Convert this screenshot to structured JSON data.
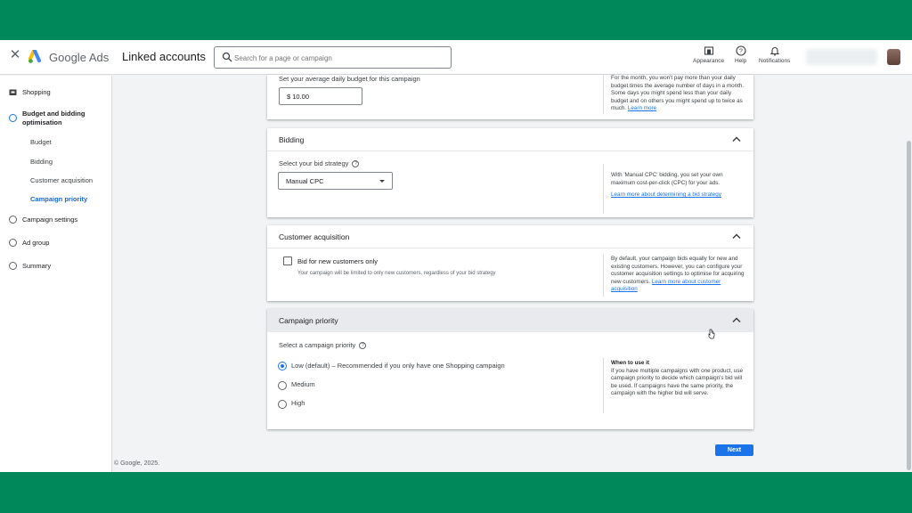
{
  "header": {
    "brand": "Google Ads",
    "page_title": "Linked accounts",
    "search_placeholder": "Search for a page or campaign",
    "tools": [
      {
        "label": "Appearance",
        "icon": "appearance-icon"
      },
      {
        "label": "Help",
        "icon": "help-icon"
      },
      {
        "label": "Notifications",
        "icon": "bell-icon"
      }
    ]
  },
  "sidebar": {
    "items": [
      {
        "label": "Shopping",
        "icon": "shopping-icon"
      },
      {
        "label": "Budget and bidding optimisation",
        "icon": "step-circle-icon",
        "active": true
      },
      {
        "label": "Campaign settings",
        "icon": "step-circle-icon"
      },
      {
        "label": "Ad group",
        "icon": "step-circle-icon"
      },
      {
        "label": "Summary",
        "icon": "step-circle-icon"
      }
    ],
    "sub_items": [
      "Budget",
      "Bidding",
      "Customer acquisition",
      "Campaign priority"
    ],
    "active_sub_item": "Campaign priority"
  },
  "budget": {
    "label": "Set your average daily budget for this campaign",
    "value": "$ 10.00",
    "help_text": "For the month, you won't pay more than your daily budget times the average number of days in a month. Some days you might spend less than your daily budget and on others you might spend up to twice as much.",
    "help_link": "Learn more"
  },
  "bidding": {
    "title": "Bidding",
    "label": "Select your bid strategy",
    "selected": "Manual CPC",
    "help_text": "With 'Manual CPC' bidding, you set your own maximum cost-per-click (CPC) for your ads.",
    "help_link": "Learn more about determining a bid strategy"
  },
  "customer_acquisition": {
    "title": "Customer acquisition",
    "checkbox_label": "Bid for new customers only",
    "checkbox_checked": false,
    "checkbox_desc": "Your campaign will be limited to only new customers, regardless of your bid strategy",
    "help_text": "By default, your campaign bids equally for new and existing customers. However, you can configure your customer acquisition settings to optimise for acquiring new customers.",
    "help_link": "Learn more about customer acquisition"
  },
  "campaign_priority": {
    "title": "Campaign priority",
    "label": "Select a campaign priority",
    "options": [
      {
        "label": "Low (default) – Recommended if you only have one Shopping campaign",
        "selected": true
      },
      {
        "label": "Medium",
        "selected": false
      },
      {
        "label": "High",
        "selected": false
      }
    ],
    "help_title": "When to use it",
    "help_text": "If you have multiple campaigns with one product, use campaign priority to decide which campaign's bid will be used. If campaigns have the same priority, the campaign with the higher bid will serve."
  },
  "footer": {
    "copyright": "© Google, 2025.",
    "next_label": "Next"
  },
  "colors": {
    "frame": "#00875a",
    "accent": "#1a73e8"
  }
}
